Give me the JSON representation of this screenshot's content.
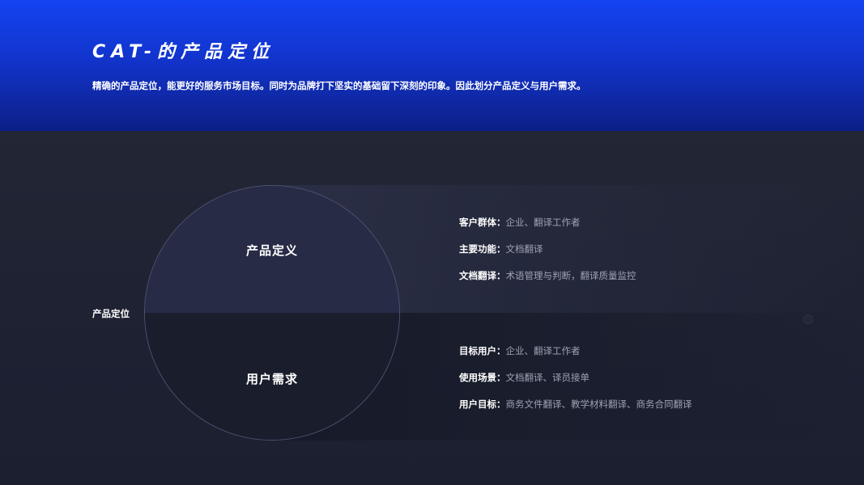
{
  "header": {
    "title": "CAT-的产品定位",
    "subtitle": "精确的产品定位，能更好的服务市场目标。同时为品牌打下坚实的基础留下深刻的印象。因此划分产品定义与用户需求。"
  },
  "diagram": {
    "side_label": "产品定位",
    "top_half_label": "产品定义",
    "bottom_half_label": "用户需求"
  },
  "product_definition": [
    {
      "key": "客户群体：",
      "value": "企业、翻译工作者"
    },
    {
      "key": "主要功能：",
      "value": "文档翻译"
    },
    {
      "key": "文档翻译：",
      "value": "术语管理与判断，翻译质量监控"
    }
  ],
  "user_needs": [
    {
      "key": "目标用户：",
      "value": "企业、翻译工作者"
    },
    {
      "key": "使用场景：",
      "value": "文档翻译、译员接单"
    },
    {
      "key": "用户目标：",
      "value": "商务文件翻译、教学材料翻译、商务合同翻译"
    }
  ],
  "colors": {
    "header_blue": "#1443f2",
    "background": "#1e2233",
    "value_text": "#9da2b4"
  }
}
